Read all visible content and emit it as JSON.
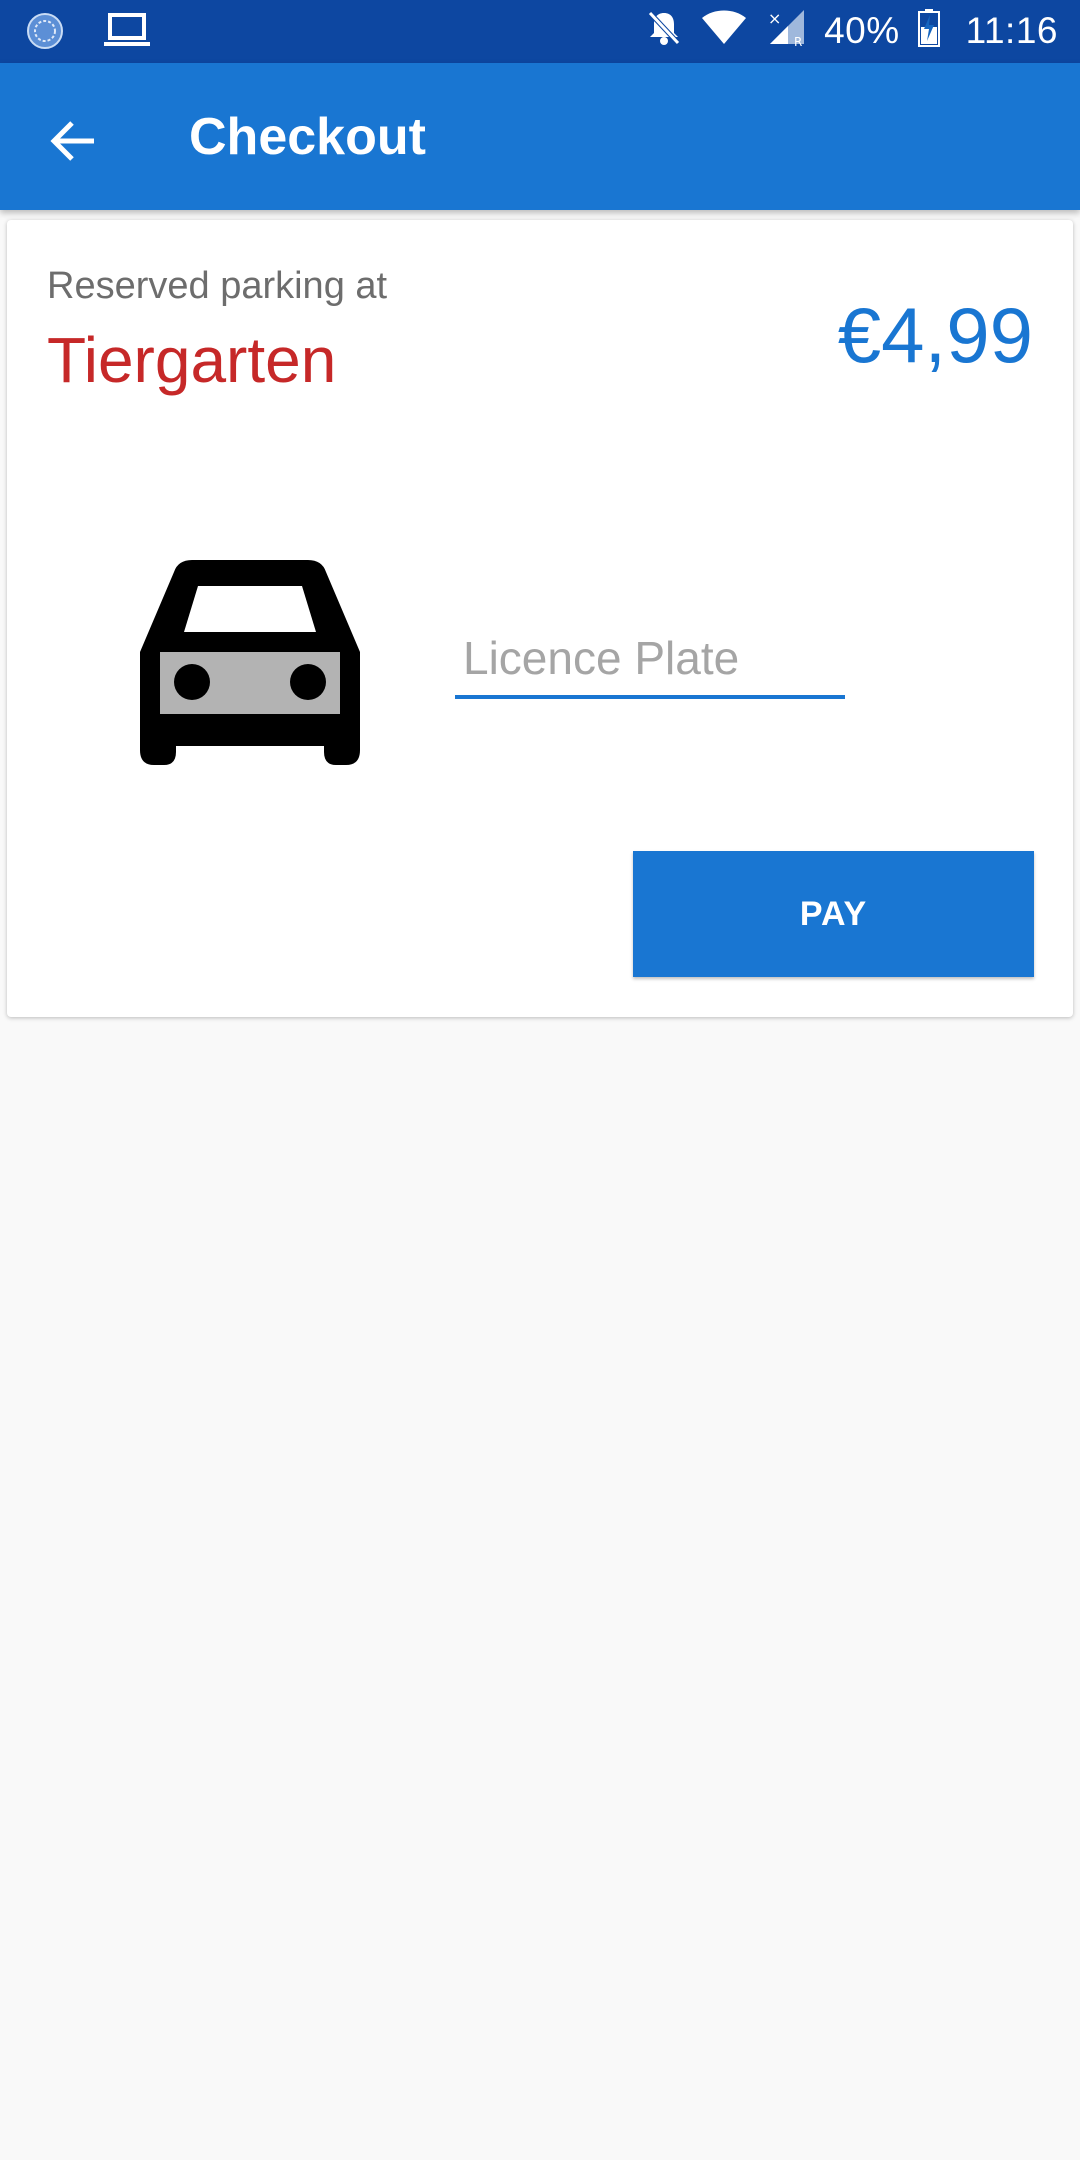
{
  "status_bar": {
    "battery_percent": "40%",
    "time": "11:16",
    "icons": [
      "app-notification-icon",
      "laptop-icon",
      "bell-off-icon",
      "wifi-icon",
      "cell-signal-icon",
      "battery-charging-icon"
    ]
  },
  "app_bar": {
    "title": "Checkout",
    "back_icon": "arrow-back-icon"
  },
  "reservation": {
    "label": "Reserved parking at",
    "location": "Tiergarten",
    "price": "€4,99"
  },
  "form": {
    "licence_plate_placeholder": "Licence Plate",
    "licence_plate_value": "",
    "car_icon": "car-icon"
  },
  "actions": {
    "pay_label": "PAY"
  },
  "colors": {
    "status_bar": "#0d47a1",
    "primary": "#1976d2",
    "location_red": "#c62828",
    "background": "#f9f9f9"
  }
}
